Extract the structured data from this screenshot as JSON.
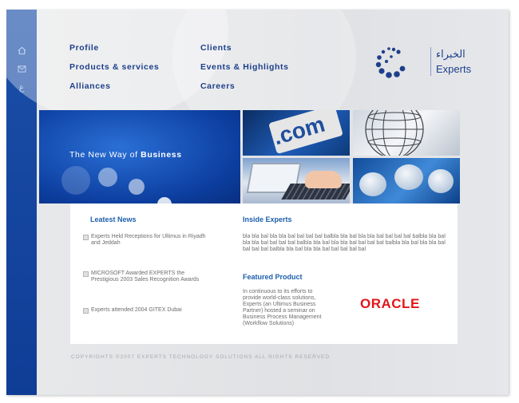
{
  "sidebar": {
    "icons": [
      "home-icon",
      "mail-icon",
      "arabic-letter-icon"
    ]
  },
  "nav": {
    "profile": "Profile",
    "products": "Products & services",
    "alliances": "Alliances",
    "clients": "Clients",
    "events": "Events & Highlights",
    "careers": "Careers"
  },
  "logo": {
    "arabic": "الخبراء",
    "english": "Experts"
  },
  "banner": {
    "prefix": "The New Way of",
    "bold": "Business"
  },
  "photos": {
    "dotcom_text": ".com"
  },
  "news": {
    "title": "Leatest News",
    "items": [
      "Experts Held Receptions for Ultimus in Riyadh and Jeddah",
      "MICROSOFT Awarded EXPERTS the Prestigious 2003 Sales Recognition Awards",
      "Experts attended 2004 GITEX Dubai"
    ]
  },
  "inside": {
    "title": "Inside Experts",
    "text": "bla bla bal bla bla bal bal bal bal balbla bla bal bla bla bal bal bal bal balbla bla bal bla bla bal bal bal bal balbla bla bal bla bla bal bal bal bal balbla bla bal bla bla bal bal bal bal balbla bla bal bla bla bal bal bal bal bal"
  },
  "featured": {
    "title": "Featured Product",
    "text": "In continuous to its efforts to provide world-class solutions, Experts (an Ultimus Business Partner) hosted a seminar on Business Process Management (Workflow Solutions)",
    "logo": "ORACLE"
  },
  "footer": {
    "copyright": "COPYRIGHTS ©2007 EXPERTS TECHNOLOGY SOLUTIONS ALL RIGHTS RESERVED"
  },
  "colors": {
    "brand_blue": "#1d3f8a",
    "sidebar_blue": "#1b4fa8",
    "oracle_red": "#e3161b",
    "heading_blue": "#1d5fab"
  }
}
